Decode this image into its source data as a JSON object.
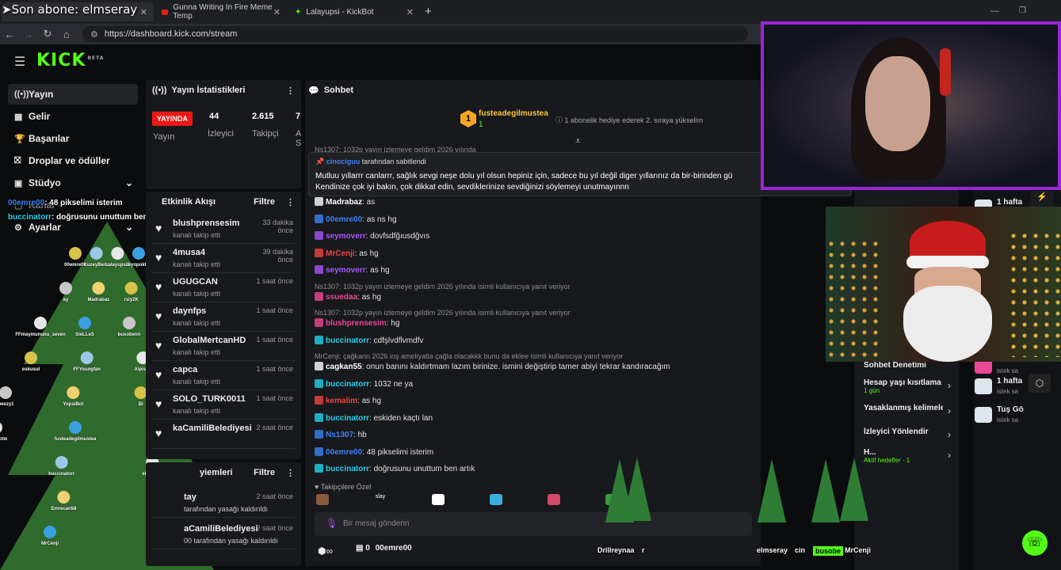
{
  "overlay_title": "Son abone: elmseray",
  "tabs": [
    {
      "title": "",
      "icon": "kick-icon"
    },
    {
      "title": "Gunna Writing In Fire Meme Temp",
      "icon": "youtube-icon"
    },
    {
      "title": "Lalayupsi - KickBot",
      "icon": "kickbot-icon"
    }
  ],
  "address": {
    "url": "https://dashboard.kick.com/stream"
  },
  "logo": {
    "text": "KICK",
    "beta": "BETA"
  },
  "sidebar": {
    "items": [
      {
        "label": "Yayın",
        "icon": "broadcast-icon"
      },
      {
        "label": "Gelir",
        "icon": "revenue-icon"
      },
      {
        "label": "Başarılar",
        "icon": "trophy-icon"
      },
      {
        "label": "Droplar ve ödüller",
        "icon": "gift-icon"
      },
      {
        "label": "Stüdyo",
        "icon": "studio-icon"
      },
      {
        "label": "Kanal",
        "icon": "channel-icon"
      },
      {
        "label": "Ayarlar",
        "icon": "settings-icon"
      }
    ]
  },
  "stats": {
    "title": "Yayın İstatistikleri",
    "live": "YAYINDA",
    "status": "Yayın",
    "viewers": "44",
    "viewers_label": "İzleyici",
    "followers": "2.615",
    "followers_label": "Takipçi",
    "third": "7",
    "third_label": "A S"
  },
  "activity": {
    "title": "Etkinlik Akışı",
    "filter": "Filtre",
    "items": [
      {
        "name": "blushprensesim",
        "sub": "kanalı takip etti",
        "time": "33 dakika önce"
      },
      {
        "name": "4musa4",
        "sub": "kanalı takip etti",
        "time": "39 dakika önce"
      },
      {
        "name": "UGUGCAN",
        "sub": "kanalı takip etti",
        "time": "1 saat önce"
      },
      {
        "name": "daynfps",
        "sub": "kanalı takip etti",
        "time": "1 saat önce"
      },
      {
        "name": "GlobalMertcanHD",
        "sub": "kanalı takip etti",
        "time": "1 saat önce"
      },
      {
        "name": "capca",
        "sub": "kanalı takip etti",
        "time": "1 saat önce"
      },
      {
        "name": "SOLO_TURK0011",
        "sub": "kanalı takip etti",
        "time": "1 saat önce"
      },
      {
        "name": "kaCamiliBelediyesi",
        "sub": "",
        "time": "2 saat önce"
      }
    ]
  },
  "moderation": {
    "title": "yiemleri",
    "filter": "Filtre",
    "items": [
      {
        "name": "tay",
        "sub": "tarafından yasağı kaldırıldı",
        "time": "2 saat önce"
      },
      {
        "name": "aCamiliBelediyesi",
        "sub": "00 tarafından yasağı kaldırıldı",
        "time": "2 saat önce"
      }
    ]
  },
  "overlay_top": [
    {
      "user": "00emre00",
      "text": ": 48 pikselimi isterim"
    },
    {
      "user": "buccinatorr",
      "text": ": doğrusunu unuttum ben artık"
    }
  ],
  "chat": {
    "title": "Sohbet",
    "sub_user": "fusteadegilmustea",
    "sub_count": "1",
    "sub_note": "1 abonelik hediye ederek 2. sıraya yükseliın",
    "top_reply": "Ns1307: 1032p yayın izlemeye geldim 2026 yılında",
    "pinned": {
      "by": "cinociguu",
      "by_text": "tarafından sabitlendi",
      "text1": "Mutluu yıllarrr canlarrr, sağlık sevgi neşe dolu yıl olsun hepiniz için, sadece bu yıl değil diger yıllarınız da bir-birinden gü",
      "text2": "Kendinize çok iyi bakın, çok dikkat edin, sevdiklerinize sevdiğinizi söylemeyi unutmayınnn"
    },
    "messages": [
      {
        "user": "Madrabaz",
        "text": ": as",
        "color": "#ffffff"
      },
      {
        "user": "00emre00",
        "text": ": as ns hg",
        "color": "#3b82f6"
      },
      {
        "user": "seymoverr",
        "text": ": dovfsdfğıusdğvıs",
        "color": "#a855f7"
      },
      {
        "user": "MrCenji",
        "text": ": as hg",
        "color": "#ef4444"
      },
      {
        "user": "seymoverr",
        "text": ": as hg",
        "color": "#a855f7"
      },
      {
        "user": "ssuedaa",
        "text": ": as hg",
        "color": "#ec4899",
        "reply": "Ns1307: 1032p yayın izlemeye geldim 2026 yılında isimli kullanıcıya yanıt veriyor"
      },
      {
        "user": "blushprensesim",
        "text": ": hg",
        "color": "#ec4899",
        "reply": "Ns1307: 1032p yayın izlemeye geldim 2026 yılında isimli kullanıcıya yanıt veriyor"
      },
      {
        "user": "buccinatorr",
        "text": ": cdfşlvdflvmdfv",
        "color": "#22d3ee"
      },
      {
        "user": "cagkan55",
        "text": ": onun banını kaldırtmam lazım birinize. ismini değiştirip tamer abiyi tekrar kandıracağım",
        "color": "#ffffff",
        "reply": "MrCenji: çağkann 2026 inş ameliyatla çağla olacakkk bunu da eklee isimli kullanıcıya yanıt veriyor"
      },
      {
        "user": "buccinatorr",
        "text": ": 1032 ne ya",
        "color": "#22d3ee"
      },
      {
        "user": "kemalim",
        "text": ": as hg",
        "color": "#ef4444"
      },
      {
        "user": "buccinatorr",
        "text": ": eskiden kaçtı lan",
        "color": "#22d3ee"
      },
      {
        "user": "Ns1307",
        "text": ": hb",
        "color": "#3b82f6"
      },
      {
        "user": "00emre00",
        "text": ": 48 pikselimi isterim",
        "color": "#3b82f6"
      },
      {
        "user": "buccinatorr",
        "text": ": doğrusunu unuttum ben artık",
        "color": "#22d3ee"
      }
    ],
    "followers_only": "Takipçilere Özel",
    "emotes": [
      "",
      "slay",
      "",
      "",
      "",
      ""
    ],
    "input_placeholder": "Bir mesaj gönderin",
    "bottom_user": "00emre00",
    "bottom_count": "0"
  },
  "mod_panel": {
    "items": [
      {
        "label": "Sohbet Denetimi"
      },
      {
        "label": "Hesap yaşı kısıtlama",
        "sub": "1 gün"
      },
      {
        "label": "Yasaklanmış kelimele"
      },
      {
        "label": "İzleyici Yönlendir"
      },
      {
        "label": "H...",
        "sub": "Aktif hedefler · 1"
      }
    ]
  },
  "right_panel": {
    "items": [
      {
        "label": "1 hafta",
        "sub": ""
      },
      {
        "label": "",
        "sub": "istek sa"
      },
      {
        "label": "1 hafta",
        "sub": "istek sa"
      },
      {
        "label": "Tuş Gö",
        "sub": "istek sa"
      }
    ]
  },
  "bottom_names": [
    "Drillreynaa",
    "r",
    "elmseray",
    "cin",
    "busobe",
    "MrCenji"
  ],
  "tree_names": [
    "00emre00",
    "KuzeyBenc",
    "Lalayupsi2",
    "zeynpoktay",
    "ay",
    "Madrabaz",
    "rsly2K",
    "oung",
    "FFmaymununu_seven",
    "SieLLeS",
    "busobenn",
    "netheira",
    "eskusul",
    "FFYoungfan",
    "Alpisko",
    "Yupsi",
    "weezy1",
    "YupsiBot",
    "Bi",
    "Iko",
    "Selambtw",
    "fusteadegilmustea",
    "kubra_1",
    "Mlizeb",
    "Lgnkmnc",
    "buccinatorr",
    "elmseray",
    "cinociguu",
    "kemalim",
    "Emrecan58",
    "seymo",
    "Flufran",
    "Talhaserv",
    "MrCenji"
  ]
}
